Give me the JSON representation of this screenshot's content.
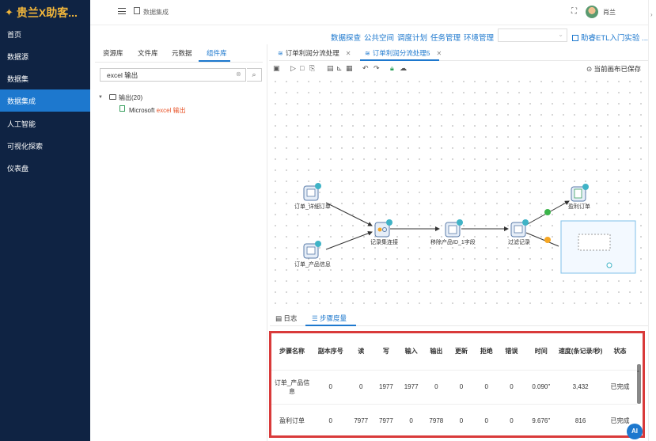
{
  "app": {
    "logo": "贵兰X助客...",
    "breadcrumb": "数据集成",
    "username": "肖兰"
  },
  "sidebar": {
    "items": [
      {
        "label": "首页",
        "active": false
      },
      {
        "label": "数据源",
        "active": false
      },
      {
        "label": "数据集",
        "active": false
      },
      {
        "label": "数据集成",
        "active": true
      },
      {
        "label": "人工智能",
        "active": false
      },
      {
        "label": "可视化探索",
        "active": false
      },
      {
        "label": "仪表盘",
        "active": false
      }
    ]
  },
  "menu": {
    "links": [
      "数据探查",
      "公共空间",
      "调度计划",
      "任务管理",
      "环境管理"
    ],
    "project": "助睿ETL入门实验 ..."
  },
  "left_panel": {
    "tabs": [
      "资源库",
      "文件库",
      "元数据",
      "组件库"
    ],
    "active_tab": "组件库",
    "search_value": "excel 输出",
    "tree": {
      "root": "输出(20)",
      "leaf_prefix": "Microsoft ",
      "leaf_highlight": "excel 输出"
    }
  },
  "editor": {
    "tabs": [
      {
        "label": "订单利润分流处理",
        "active": false
      },
      {
        "label": "订单利润分流处理5",
        "active": true
      }
    ],
    "status": "当前画布已保存"
  },
  "canvas": {
    "nodes": [
      {
        "id": "n1",
        "label": "订单_详细订单"
      },
      {
        "id": "n2",
        "label": "订单_产品信息"
      },
      {
        "id": "n3",
        "label": "记录集连接"
      },
      {
        "id": "n4",
        "label": "移除产品ID_1字段"
      },
      {
        "id": "n5",
        "label": "过滤记录"
      },
      {
        "id": "n6",
        "label": "盈利订单"
      }
    ]
  },
  "bottom": {
    "tabs": [
      "日志",
      "步骤度量"
    ],
    "active_tab": "步骤度量",
    "columns": [
      "步骤名称",
      "副本序号",
      "读",
      "写",
      "输入",
      "输出",
      "更新",
      "拒绝",
      "错误",
      "时间",
      "速度(条记录/秒)",
      "状态"
    ],
    "rows": [
      [
        "订单_产品信息",
        "0",
        "0",
        "1977",
        "1977",
        "0",
        "0",
        "0",
        "0",
        "0.090\"",
        "3,432",
        "已完成"
      ],
      [
        "盈利订单",
        "0",
        "7977",
        "7977",
        "0",
        "7978",
        "0",
        "0",
        "0",
        "9.676\"",
        "816",
        "已完成"
      ]
    ]
  },
  "ai_button": "AI"
}
